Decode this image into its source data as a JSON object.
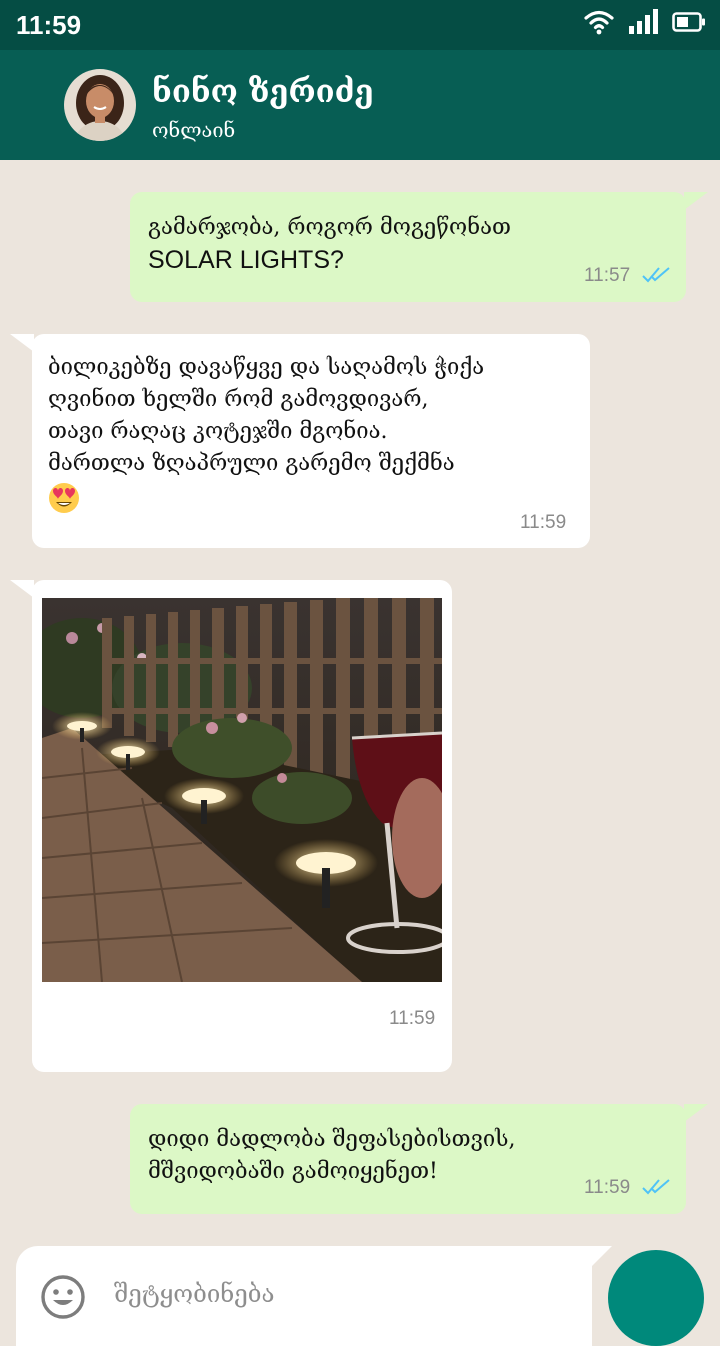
{
  "status_bar": {
    "time": "11:59"
  },
  "header": {
    "contact_name": "ნინო ზერიძე",
    "contact_status": "ონლაინ"
  },
  "messages": [
    {
      "direction": "outgoing",
      "line1": "გამარჯობა, როგორ მოგეწონათ",
      "line2": "SOLAR LIGHTS?",
      "time": "11:57",
      "read": true
    },
    {
      "direction": "incoming",
      "lines": [
        "ბილიკებზე დავაწყვე და საღამოს ჭიქა",
        "ღვინით ხელში რომ გამოვდივარ,",
        "თავი რაღაც კოტეჯში მგონია.",
        "მართლა ზღაპრული გარემო შექმნა"
      ],
      "emoji": "smiling-face-with-heart-eyes",
      "time": "11:59"
    },
    {
      "direction": "incoming",
      "type": "photo",
      "photo_subject": "solar path lights along a brick garden path with a glass of red wine",
      "time": "11:59"
    },
    {
      "direction": "outgoing",
      "line1": "დიდი მადლობა შეფასებისთვის,",
      "line2": "მშვიდობაში გამოიყენეთ!",
      "time": "11:59",
      "read": true
    }
  ],
  "composer": {
    "placeholder": "შეტყობინება"
  },
  "colors": {
    "status_bar": "#054d44",
    "header": "#075e54",
    "chat_background": "#ece5dd",
    "outgoing_bubble": "#dcf8c6",
    "incoming_bubble": "#ffffff",
    "read_ticks": "#4fc3f7",
    "send_button": "#00897b"
  },
  "icons": [
    "wifi-icon",
    "signal-icon",
    "battery-icon",
    "emoji-icon",
    "double-check-icon"
  ]
}
